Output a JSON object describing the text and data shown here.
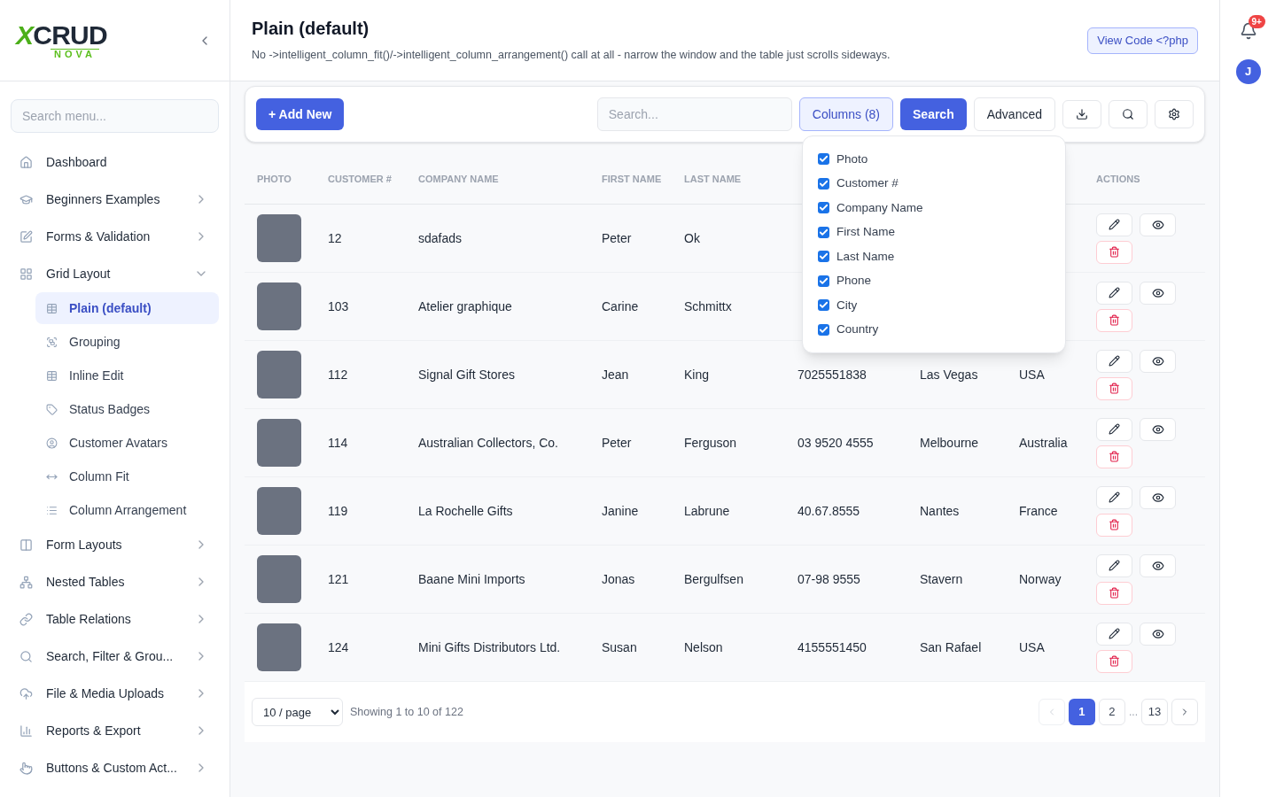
{
  "logo": {
    "name": "XCRUD",
    "tagline": "NOVA"
  },
  "sidebar": {
    "search": {
      "placeholder": "Search menu..."
    },
    "items": [
      {
        "label": "Dashboard",
        "kind": "link"
      },
      {
        "label": "Beginners Examples",
        "kind": "group",
        "expanded": false
      },
      {
        "label": "Forms & Validation",
        "kind": "group",
        "expanded": false
      },
      {
        "label": "Grid Layout",
        "kind": "group",
        "expanded": true,
        "children": [
          {
            "label": "Plain (default)",
            "selected": true
          },
          {
            "label": "Grouping",
            "selected": false
          },
          {
            "label": "Inline Edit",
            "selected": false
          },
          {
            "label": "Status Badges",
            "selected": false
          },
          {
            "label": "Customer Avatars",
            "selected": false
          },
          {
            "label": "Column Fit",
            "selected": false
          },
          {
            "label": "Column Arrangement",
            "selected": false
          }
        ]
      },
      {
        "label": "Form Layouts",
        "kind": "group",
        "expanded": false
      },
      {
        "label": "Nested Tables",
        "kind": "group",
        "expanded": false
      },
      {
        "label": "Table Relations",
        "kind": "group",
        "expanded": false
      },
      {
        "label": "Search, Filter & Grou...",
        "kind": "group",
        "expanded": false
      },
      {
        "label": "File & Media Uploads",
        "kind": "group",
        "expanded": false
      },
      {
        "label": "Reports & Export",
        "kind": "group",
        "expanded": false
      },
      {
        "label": "Buttons & Custom Act...",
        "kind": "group",
        "expanded": false
      }
    ]
  },
  "page": {
    "title": "Plain (default)",
    "description": "No ->intelligent_column_fit()/->intelligent_column_arrangement() call at all - narrow the window and the table just scrolls sideways.",
    "view_code": "View Code <?php"
  },
  "header": {
    "notifications": "9+",
    "avatar": "J"
  },
  "toolbar": {
    "add_new": "+ Add New",
    "search": {
      "placeholder": "Search..."
    },
    "columns_button": "Columns (8)",
    "search_button": "Search",
    "advanced_button": "Advanced"
  },
  "columns_menu": [
    {
      "label": "Photo",
      "checked": true
    },
    {
      "label": "Customer #",
      "checked": true
    },
    {
      "label": "Company Name",
      "checked": true
    },
    {
      "label": "First Name",
      "checked": true
    },
    {
      "label": "Last Name",
      "checked": true
    },
    {
      "label": "Phone",
      "checked": true
    },
    {
      "label": "City",
      "checked": true
    },
    {
      "label": "Country",
      "checked": true
    }
  ],
  "table": {
    "columns": [
      "PHOTO",
      "CUSTOMER #",
      "COMPANY NAME",
      "FIRST NAME",
      "LAST NAME",
      "",
      "",
      "",
      "ACTIONS"
    ],
    "rows": [
      {
        "customer": "12",
        "company": "sdafads",
        "first": "Peter",
        "last": "Ok"
      },
      {
        "customer": "103",
        "company": "Atelier graphique",
        "first": "Carine",
        "last": "Schmittx"
      },
      {
        "customer": "112",
        "company": "Signal Gift Stores",
        "first": "Jean",
        "last": "King",
        "phone": "7025551838",
        "city": "Las Vegas",
        "country": "USA"
      },
      {
        "customer": "114",
        "company": "Australian Collectors, Co.",
        "first": "Peter",
        "last": "Ferguson",
        "phone": "03 9520 4555",
        "city": "Melbourne",
        "country": "Australia"
      },
      {
        "customer": "119",
        "company": "La Rochelle Gifts",
        "first": "Janine",
        "last": "Labrune",
        "phone": "40.67.8555",
        "city": "Nantes",
        "country": "France"
      },
      {
        "customer": "121",
        "company": "Baane Mini Imports",
        "first": "Jonas",
        "last": "Bergulfsen",
        "phone": "07-98 9555",
        "city": "Stavern",
        "country": "Norway"
      },
      {
        "customer": "124",
        "company": "Mini Gifts Distributors Ltd.",
        "first": "Susan",
        "last": "Nelson",
        "phone": "4155551450",
        "city": "San Rafael",
        "country": "USA"
      }
    ]
  },
  "footer": {
    "page_size": "10 / page",
    "summary": "Showing 1 to 10 of 122",
    "pages": [
      {
        "label": "1",
        "selected": true
      },
      {
        "label": "2",
        "selected": false
      },
      {
        "label": "...",
        "kind": "ellipsis"
      },
      {
        "label": "13",
        "selected": false
      }
    ],
    "prev_disabled": true
  }
}
